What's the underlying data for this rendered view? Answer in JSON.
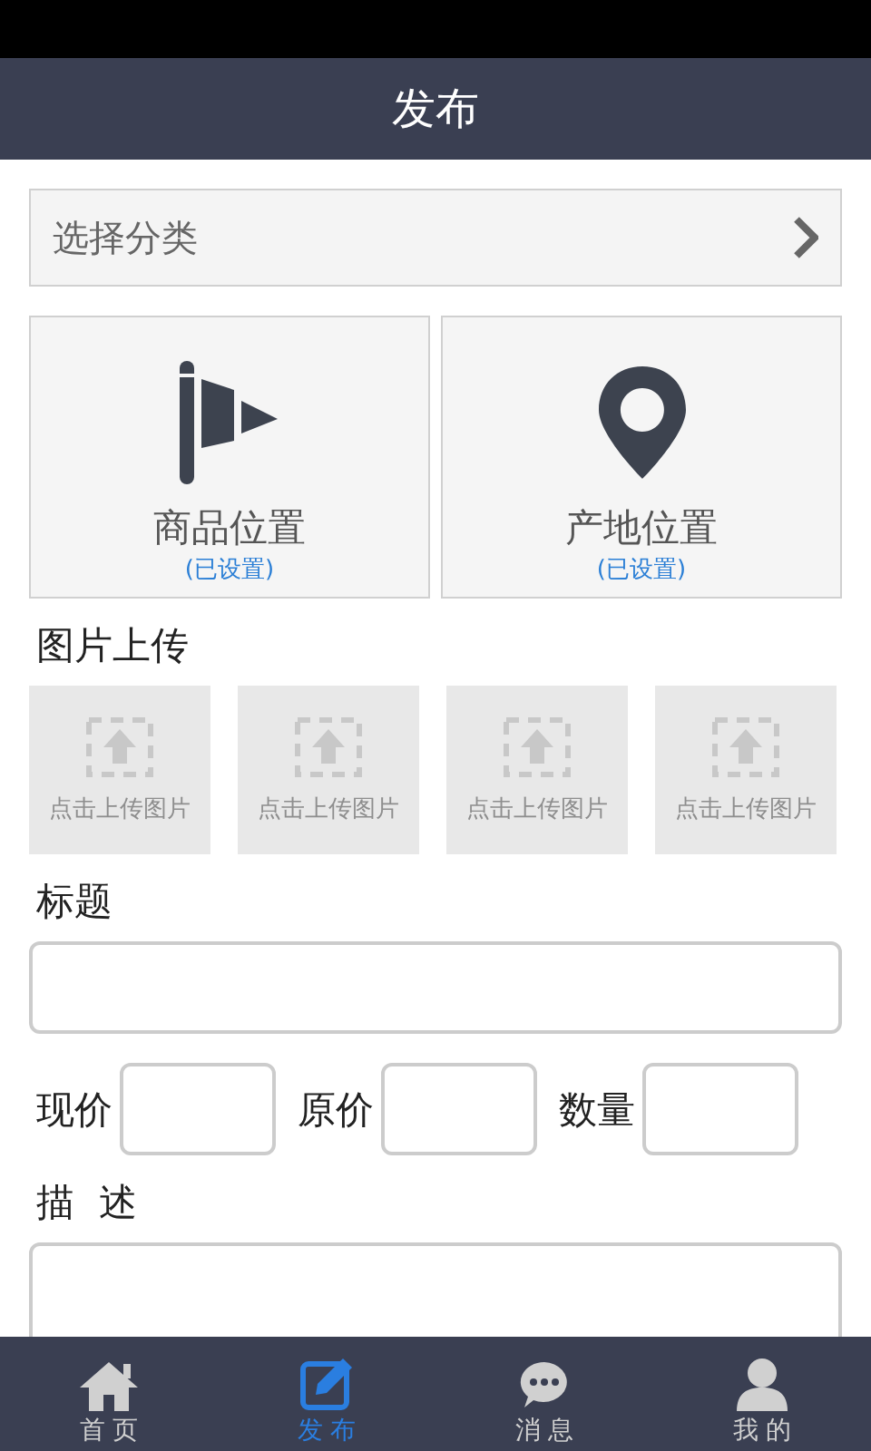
{
  "header": {
    "title": "发布"
  },
  "category": {
    "placeholder": "选择分类"
  },
  "locations": [
    {
      "kind": "flag",
      "label": "商品位置",
      "status": "(已设置)"
    },
    {
      "kind": "pin",
      "label": "产地位置",
      "status": "(已设置)"
    }
  ],
  "upload": {
    "title": "图片上传",
    "tiles": [
      "点击上传图片",
      "点击上传图片",
      "点击上传图片",
      "点击上传图片"
    ]
  },
  "title_field": {
    "label": "标题"
  },
  "price_row": [
    {
      "label": "现价"
    },
    {
      "label": "原价"
    },
    {
      "label": "数量"
    }
  ],
  "description": {
    "label": "描  述"
  },
  "bottom_nav": [
    {
      "kind": "home",
      "label": "首 页",
      "selected": false
    },
    {
      "kind": "edit",
      "label": "发 布",
      "selected": true
    },
    {
      "kind": "chat",
      "label": "消 息",
      "selected": false
    },
    {
      "kind": "user",
      "label": "我 的",
      "selected": false
    }
  ]
}
